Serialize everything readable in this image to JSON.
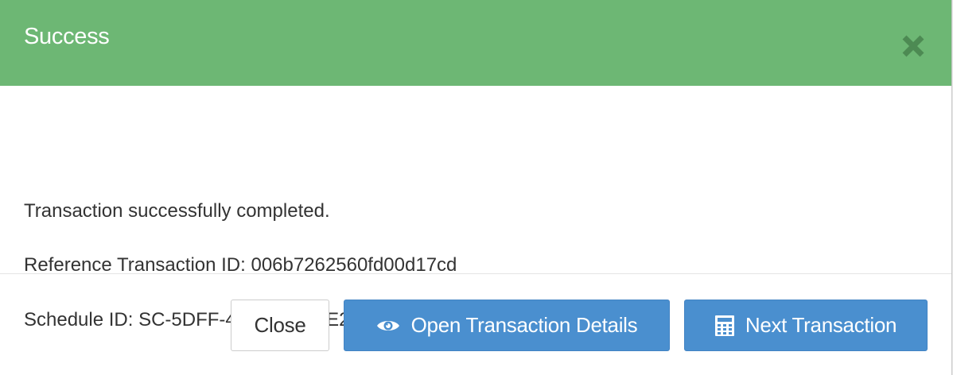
{
  "header": {
    "title": "Success",
    "close_icon": "close-x-icon",
    "background_color": "#6db774"
  },
  "body": {
    "message": "Transaction successfully completed.",
    "reference_line": "Reference Transaction ID: 006b7262560fd00d17cd",
    "schedule_line": "Schedule ID: SC-5DFF-4246-756C-E24D-0868-DFC6"
  },
  "footer": {
    "close_label": "Close",
    "open_details_label": "Open Transaction Details",
    "open_details_icon": "eye-icon",
    "next_label": "Next Transaction",
    "next_icon": "calculator-icon",
    "primary_color": "#4a8fcf"
  }
}
